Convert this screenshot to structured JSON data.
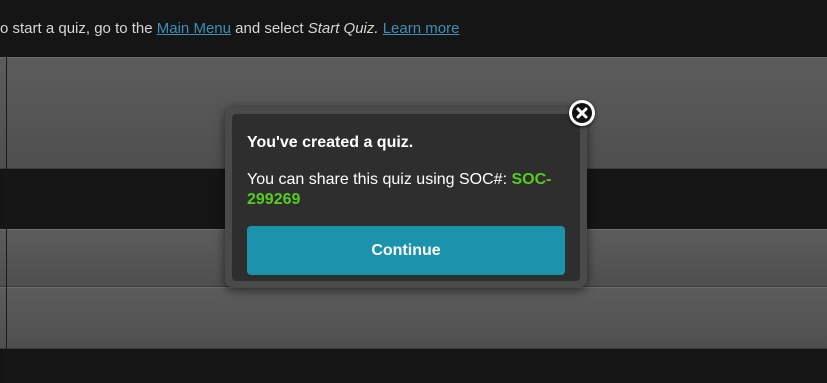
{
  "notice": {
    "prefix": "o start a quiz, go to the ",
    "main_menu_link": "Main Menu",
    "middle": " and select ",
    "start_quiz": "Start Quiz.",
    "space": " ",
    "learn_more_link": "Learn more"
  },
  "modal": {
    "title": "You've created a quiz.",
    "message": "You can share this quiz using SOC#: ",
    "soc_code": "SOC-299269",
    "continue_label": "Continue",
    "close_icon": "close-icon"
  },
  "colors": {
    "accent_button": "#1b93ac",
    "soc_code": "#55cc1e",
    "link": "#3d8fb8"
  }
}
